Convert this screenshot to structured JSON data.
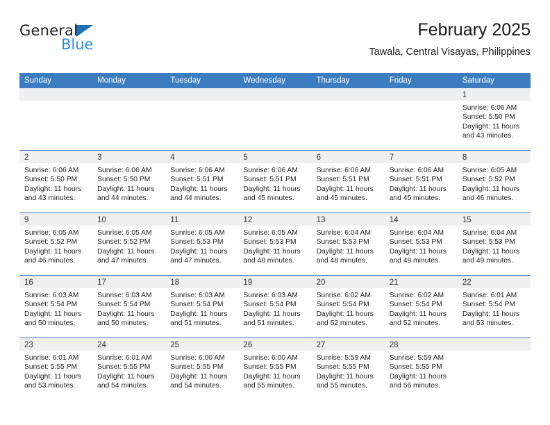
{
  "brand": {
    "name_dark": "General",
    "name_blue": "Blue",
    "triangle_color": "#1f6fb5",
    "blue_color": "#2d8fd5"
  },
  "header": {
    "title": "February 2025",
    "subtitle": "Tawala, Central Visayas, Philippines"
  },
  "theme": {
    "header_bg": "#3b7dc0",
    "header_text": "#ffffff",
    "daynum_band_bg": "#efefef",
    "row_divider": "#3b7dc0"
  },
  "weekdays": [
    "Sunday",
    "Monday",
    "Tuesday",
    "Wednesday",
    "Thursday",
    "Friday",
    "Saturday"
  ],
  "labels": {
    "sunrise": "Sunrise:",
    "sunset": "Sunset:",
    "daylight": "Daylight:"
  },
  "weeks": [
    [
      {
        "day": "",
        "l1": "",
        "l2": "",
        "l3": "",
        "l4": ""
      },
      {
        "day": "",
        "l1": "",
        "l2": "",
        "l3": "",
        "l4": ""
      },
      {
        "day": "",
        "l1": "",
        "l2": "",
        "l3": "",
        "l4": ""
      },
      {
        "day": "",
        "l1": "",
        "l2": "",
        "l3": "",
        "l4": ""
      },
      {
        "day": "",
        "l1": "",
        "l2": "",
        "l3": "",
        "l4": ""
      },
      {
        "day": "",
        "l1": "",
        "l2": "",
        "l3": "",
        "l4": ""
      },
      {
        "day": "1",
        "l1": "Sunrise: 6:06 AM",
        "l2": "Sunset: 5:50 PM",
        "l3": "Daylight: 11 hours",
        "l4": "and 43 minutes."
      }
    ],
    [
      {
        "day": "2",
        "l1": "Sunrise: 6:06 AM",
        "l2": "Sunset: 5:50 PM",
        "l3": "Daylight: 11 hours",
        "l4": "and 43 minutes."
      },
      {
        "day": "3",
        "l1": "Sunrise: 6:06 AM",
        "l2": "Sunset: 5:50 PM",
        "l3": "Daylight: 11 hours",
        "l4": "and 44 minutes."
      },
      {
        "day": "4",
        "l1": "Sunrise: 6:06 AM",
        "l2": "Sunset: 5:51 PM",
        "l3": "Daylight: 11 hours",
        "l4": "and 44 minutes."
      },
      {
        "day": "5",
        "l1": "Sunrise: 6:06 AM",
        "l2": "Sunset: 5:51 PM",
        "l3": "Daylight: 11 hours",
        "l4": "and 45 minutes."
      },
      {
        "day": "6",
        "l1": "Sunrise: 6:06 AM",
        "l2": "Sunset: 5:51 PM",
        "l3": "Daylight: 11 hours",
        "l4": "and 45 minutes."
      },
      {
        "day": "7",
        "l1": "Sunrise: 6:06 AM",
        "l2": "Sunset: 5:51 PM",
        "l3": "Daylight: 11 hours",
        "l4": "and 45 minutes."
      },
      {
        "day": "8",
        "l1": "Sunrise: 6:05 AM",
        "l2": "Sunset: 5:52 PM",
        "l3": "Daylight: 11 hours",
        "l4": "and 46 minutes."
      }
    ],
    [
      {
        "day": "9",
        "l1": "Sunrise: 6:05 AM",
        "l2": "Sunset: 5:52 PM",
        "l3": "Daylight: 11 hours",
        "l4": "and 46 minutes."
      },
      {
        "day": "10",
        "l1": "Sunrise: 6:05 AM",
        "l2": "Sunset: 5:52 PM",
        "l3": "Daylight: 11 hours",
        "l4": "and 47 minutes."
      },
      {
        "day": "11",
        "l1": "Sunrise: 6:05 AM",
        "l2": "Sunset: 5:53 PM",
        "l3": "Daylight: 11 hours",
        "l4": "and 47 minutes."
      },
      {
        "day": "12",
        "l1": "Sunrise: 6:05 AM",
        "l2": "Sunset: 5:53 PM",
        "l3": "Daylight: 11 hours",
        "l4": "and 48 minutes."
      },
      {
        "day": "13",
        "l1": "Sunrise: 6:04 AM",
        "l2": "Sunset: 5:53 PM",
        "l3": "Daylight: 11 hours",
        "l4": "and 48 minutes."
      },
      {
        "day": "14",
        "l1": "Sunrise: 6:04 AM",
        "l2": "Sunset: 5:53 PM",
        "l3": "Daylight: 11 hours",
        "l4": "and 49 minutes."
      },
      {
        "day": "15",
        "l1": "Sunrise: 6:04 AM",
        "l2": "Sunset: 5:53 PM",
        "l3": "Daylight: 11 hours",
        "l4": "and 49 minutes."
      }
    ],
    [
      {
        "day": "16",
        "l1": "Sunrise: 6:03 AM",
        "l2": "Sunset: 5:54 PM",
        "l3": "Daylight: 11 hours",
        "l4": "and 50 minutes."
      },
      {
        "day": "17",
        "l1": "Sunrise: 6:03 AM",
        "l2": "Sunset: 5:54 PM",
        "l3": "Daylight: 11 hours",
        "l4": "and 50 minutes."
      },
      {
        "day": "18",
        "l1": "Sunrise: 6:03 AM",
        "l2": "Sunset: 5:54 PM",
        "l3": "Daylight: 11 hours",
        "l4": "and 51 minutes."
      },
      {
        "day": "19",
        "l1": "Sunrise: 6:03 AM",
        "l2": "Sunset: 5:54 PM",
        "l3": "Daylight: 11 hours",
        "l4": "and 51 minutes."
      },
      {
        "day": "20",
        "l1": "Sunrise: 6:02 AM",
        "l2": "Sunset: 5:54 PM",
        "l3": "Daylight: 11 hours",
        "l4": "and 52 minutes."
      },
      {
        "day": "21",
        "l1": "Sunrise: 6:02 AM",
        "l2": "Sunset: 5:54 PM",
        "l3": "Daylight: 11 hours",
        "l4": "and 52 minutes."
      },
      {
        "day": "22",
        "l1": "Sunrise: 6:01 AM",
        "l2": "Sunset: 5:54 PM",
        "l3": "Daylight: 11 hours",
        "l4": "and 53 minutes."
      }
    ],
    [
      {
        "day": "23",
        "l1": "Sunrise: 6:01 AM",
        "l2": "Sunset: 5:55 PM",
        "l3": "Daylight: 11 hours",
        "l4": "and 53 minutes."
      },
      {
        "day": "24",
        "l1": "Sunrise: 6:01 AM",
        "l2": "Sunset: 5:55 PM",
        "l3": "Daylight: 11 hours",
        "l4": "and 54 minutes."
      },
      {
        "day": "25",
        "l1": "Sunrise: 6:00 AM",
        "l2": "Sunset: 5:55 PM",
        "l3": "Daylight: 11 hours",
        "l4": "and 54 minutes."
      },
      {
        "day": "26",
        "l1": "Sunrise: 6:00 AM",
        "l2": "Sunset: 5:55 PM",
        "l3": "Daylight: 11 hours",
        "l4": "and 55 minutes."
      },
      {
        "day": "27",
        "l1": "Sunrise: 5:59 AM",
        "l2": "Sunset: 5:55 PM",
        "l3": "Daylight: 11 hours",
        "l4": "and 55 minutes."
      },
      {
        "day": "28",
        "l1": "Sunrise: 5:59 AM",
        "l2": "Sunset: 5:55 PM",
        "l3": "Daylight: 11 hours",
        "l4": "and 56 minutes."
      },
      {
        "day": "",
        "l1": "",
        "l2": "",
        "l3": "",
        "l4": ""
      }
    ]
  ]
}
